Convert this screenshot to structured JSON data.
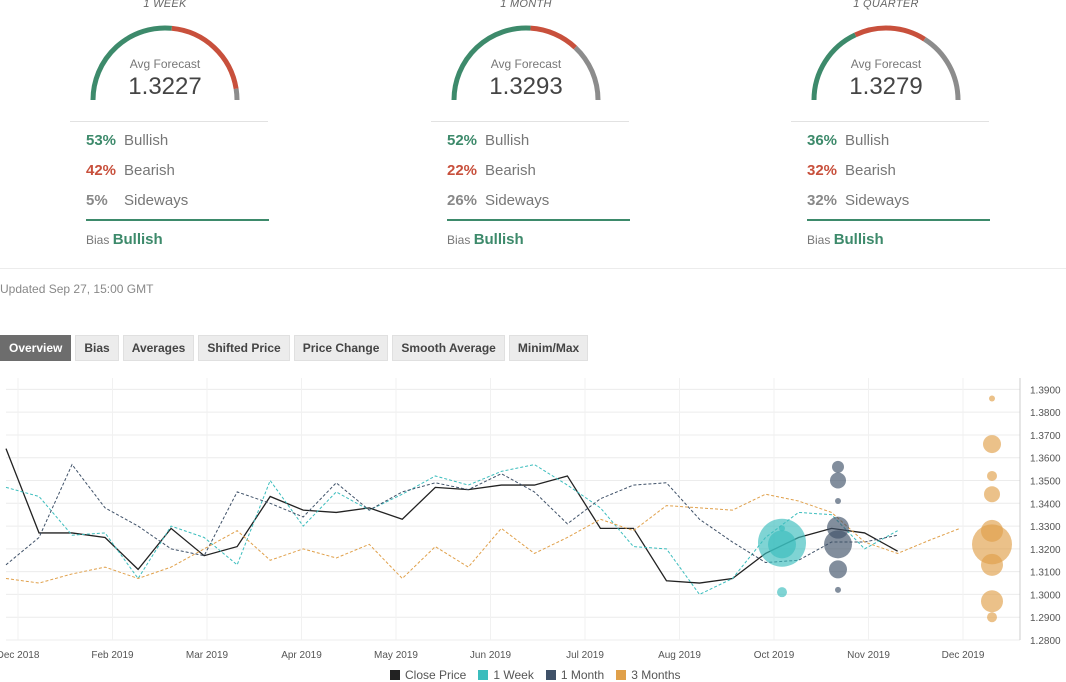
{
  "colors": {
    "bullish": "#3d8a6b",
    "bearish": "#c8503c",
    "sideways": "#8c8c8c",
    "close": "#222222",
    "week": "#3bbdbd",
    "month": "#3f5168",
    "quarter": "#e0a04a"
  },
  "panels": [
    {
      "title": "1 WEEK",
      "avg_label": "Avg Forecast",
      "avg_value": "1.3227",
      "bullish": {
        "pct": "53%",
        "label": "Bullish"
      },
      "bearish": {
        "pct": "42%",
        "label": "Bearish"
      },
      "sideways": {
        "pct": "5%",
        "label": "Sideways"
      },
      "bias_label": "Bias",
      "bias_value": "Bullish"
    },
    {
      "title": "1 MONTH",
      "avg_label": "Avg Forecast",
      "avg_value": "1.3293",
      "bullish": {
        "pct": "52%",
        "label": "Bullish"
      },
      "bearish": {
        "pct": "22%",
        "label": "Bearish"
      },
      "sideways": {
        "pct": "26%",
        "label": "Sideways"
      },
      "bias_label": "Bias",
      "bias_value": "Bullish"
    },
    {
      "title": "1 QUARTER",
      "avg_label": "Avg Forecast",
      "avg_value": "1.3279",
      "bullish": {
        "pct": "36%",
        "label": "Bullish"
      },
      "bearish": {
        "pct": "32%",
        "label": "Bearish"
      },
      "sideways": {
        "pct": "32%",
        "label": "Sideways"
      },
      "bias_label": "Bias",
      "bias_value": "Bullish"
    }
  ],
  "updated": "Updated Sep 27, 15:00 GMT",
  "tabs": [
    "Overview",
    "Bias",
    "Averages",
    "Shifted Price",
    "Price Change",
    "Smooth Average",
    "Minim/Max"
  ],
  "active_tab": "Overview",
  "chart_data": {
    "type": "line",
    "x_ticks": [
      "Dec 2018",
      "Feb 2019",
      "Mar 2019",
      "Apr 2019",
      "May 2019",
      "Jun 2019",
      "Jul 2019",
      "Aug 2019",
      "Oct 2019",
      "Nov 2019",
      "Dec 2019"
    ],
    "y_ticks": [
      "1.3900",
      "1.3800",
      "1.3700",
      "1.3600",
      "1.3500",
      "1.3400",
      "1.3300",
      "1.3200",
      "1.3100",
      "1.3000",
      "1.2900",
      "1.2800"
    ],
    "ylim": [
      1.28,
      1.395
    ],
    "xlim": [
      0,
      52
    ],
    "grid": true,
    "legend_position": "bottom-center",
    "series": [
      {
        "name": "Close Price",
        "style": "solid",
        "x": [
          0,
          1.8,
          3.6,
          5.4,
          7.2,
          9,
          10.8,
          12.6,
          14.4,
          16.2,
          18,
          19.8,
          21.6,
          23.4,
          25.2,
          27,
          28.8,
          30.6,
          32.4,
          34.2,
          36,
          37.8,
          39.6,
          41.4,
          43.2,
          45,
          46.8,
          48.6
        ],
        "y": [
          1.364,
          1.327,
          1.327,
          1.325,
          1.311,
          1.329,
          1.317,
          1.321,
          1.343,
          1.337,
          1.336,
          1.338,
          1.333,
          1.347,
          1.346,
          1.348,
          1.348,
          1.352,
          1.329,
          1.329,
          1.306,
          1.305,
          1.307,
          1.318,
          1.325,
          1.329,
          1.327,
          1.319
        ]
      },
      {
        "name": "1 Week",
        "style": "dashed",
        "x": [
          0,
          1.8,
          3.6,
          5.4,
          7.2,
          9,
          10.8,
          12.6,
          14.4,
          16.2,
          18,
          19.8,
          21.6,
          23.4,
          25.2,
          27,
          28.8,
          30.6,
          32.4,
          34.2,
          36,
          37.8,
          39.6,
          41.4,
          43.2,
          45,
          46.8,
          48.6
        ],
        "y": [
          1.347,
          1.343,
          1.326,
          1.327,
          1.307,
          1.33,
          1.325,
          1.313,
          1.35,
          1.33,
          1.345,
          1.337,
          1.344,
          1.352,
          1.348,
          1.354,
          1.357,
          1.348,
          1.338,
          1.321,
          1.32,
          1.3,
          1.307,
          1.325,
          1.336,
          1.335,
          1.32,
          1.328
        ]
      },
      {
        "name": "1 Month",
        "style": "dashed",
        "x": [
          0,
          1.8,
          3.6,
          5.4,
          7.2,
          9,
          10.8,
          12.6,
          14.4,
          16.2,
          18,
          19.8,
          21.6,
          23.4,
          25.2,
          27,
          28.8,
          30.6,
          32.4,
          34.2,
          36,
          37.8,
          39.6,
          41.4,
          43.2,
          45,
          46.8,
          48.6
        ],
        "y": [
          1.313,
          1.325,
          1.357,
          1.338,
          1.33,
          1.32,
          1.317,
          1.345,
          1.34,
          1.334,
          1.349,
          1.337,
          1.345,
          1.349,
          1.346,
          1.353,
          1.345,
          1.331,
          1.342,
          1.348,
          1.349,
          1.333,
          1.323,
          1.314,
          1.315,
          1.323,
          1.323,
          1.326
        ]
      },
      {
        "name": "3 Months",
        "style": "dashed",
        "x": [
          0,
          1.8,
          3.6,
          5.4,
          7.2,
          9,
          10.8,
          12.6,
          14.4,
          16.2,
          18,
          19.8,
          21.6,
          23.4,
          25.2,
          27,
          28.8,
          30.6,
          32.4,
          34.2,
          36,
          37.8,
          39.6,
          41.4,
          43.2,
          45,
          46.8,
          48.6,
          50.4,
          52
        ],
        "y": [
          1.307,
          1.305,
          1.309,
          1.312,
          1.307,
          1.312,
          1.32,
          1.328,
          1.315,
          1.32,
          1.316,
          1.322,
          1.307,
          1.321,
          1.312,
          1.329,
          1.318,
          1.325,
          1.333,
          1.328,
          1.339,
          1.338,
          1.337,
          1.344,
          1.341,
          1.336,
          1.323,
          1.318,
          1.324,
          1.329
        ]
      }
    ],
    "forecast_bubbles": [
      {
        "series": "1 Week",
        "points": [
          {
            "y": 1.3227,
            "size": 24
          },
          {
            "y": 1.322,
            "size": 14
          },
          {
            "y": 1.301,
            "size": 5
          },
          {
            "y": 1.329,
            "size": 3
          }
        ]
      },
      {
        "series": "1 Month",
        "points": [
          {
            "y": 1.3293,
            "size": 11
          },
          {
            "y": 1.322,
            "size": 14
          },
          {
            "y": 1.311,
            "size": 9
          },
          {
            "y": 1.356,
            "size": 6
          },
          {
            "y": 1.35,
            "size": 8
          },
          {
            "y": 1.341,
            "size": 3
          },
          {
            "y": 1.302,
            "size": 3
          }
        ]
      },
      {
        "series": "3 Months",
        "points": [
          {
            "y": 1.3279,
            "size": 11
          },
          {
            "y": 1.322,
            "size": 20
          },
          {
            "y": 1.313,
            "size": 11
          },
          {
            "y": 1.297,
            "size": 11
          },
          {
            "y": 1.366,
            "size": 9
          },
          {
            "y": 1.344,
            "size": 8
          },
          {
            "y": 1.352,
            "size": 5
          },
          {
            "y": 1.29,
            "size": 5
          },
          {
            "y": 1.386,
            "size": 3
          }
        ]
      }
    ]
  },
  "legend": [
    {
      "label": "Close Price",
      "color": "#222222"
    },
    {
      "label": "1 Week",
      "color": "#3bbdbd"
    },
    {
      "label": "1 Month",
      "color": "#3f5168"
    },
    {
      "label": "3 Months",
      "color": "#e0a04a"
    }
  ]
}
